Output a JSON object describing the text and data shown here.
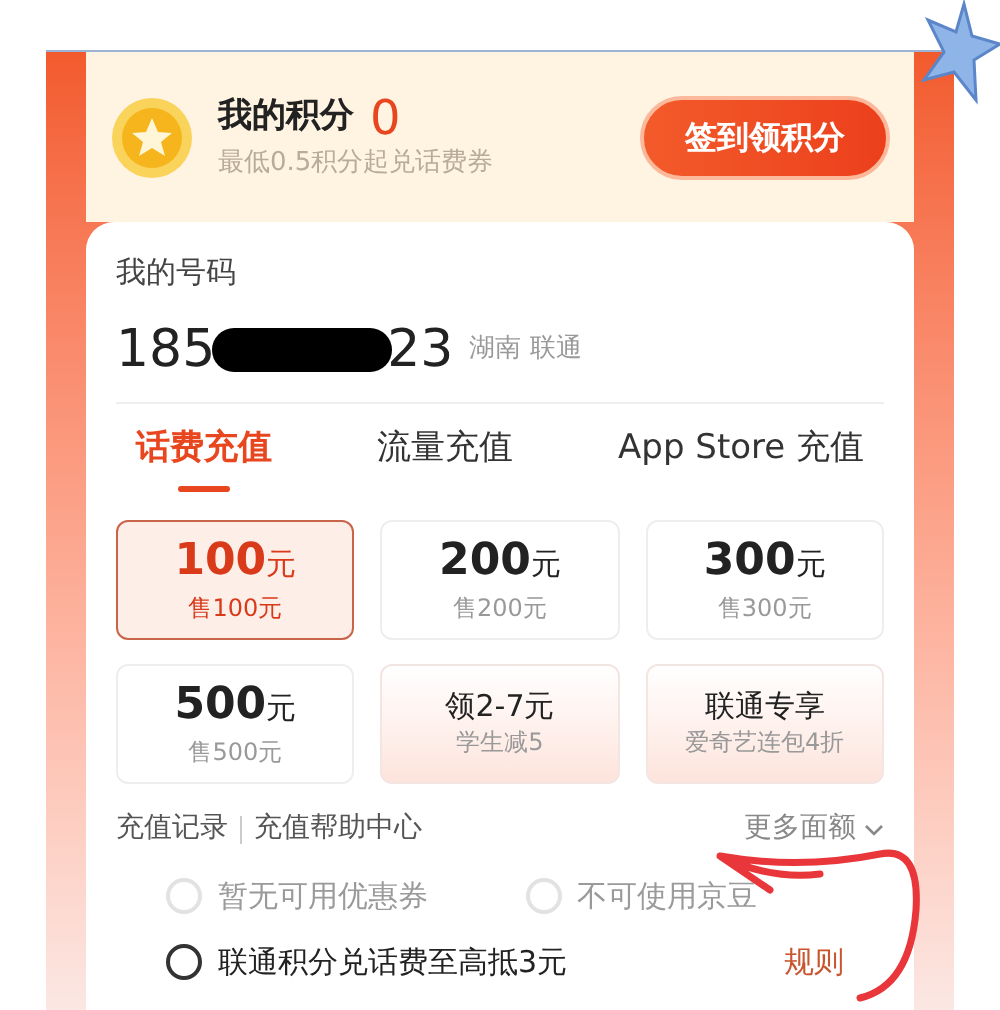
{
  "points": {
    "title": "我的积分",
    "value": "0",
    "subtitle": "最低0.5积分起兑话费券",
    "button": "签到领积分"
  },
  "number": {
    "label": "我的号码",
    "start": "185",
    "end": "23",
    "region": "湖南 联通"
  },
  "tabs": [
    {
      "label": "话费充值",
      "selected": true
    },
    {
      "label": "流量充值",
      "selected": false
    },
    {
      "label": "App Store 充值",
      "selected": false
    }
  ],
  "options": [
    {
      "kind": "amount",
      "amount": "100",
      "unit": "元",
      "sub": "售100元",
      "selected": true
    },
    {
      "kind": "amount",
      "amount": "200",
      "unit": "元",
      "sub": "售200元",
      "selected": false
    },
    {
      "kind": "amount",
      "amount": "300",
      "unit": "元",
      "sub": "售300元",
      "selected": false
    },
    {
      "kind": "amount",
      "amount": "500",
      "unit": "元",
      "sub": "售500元",
      "selected": false
    },
    {
      "kind": "promo",
      "title": "领2-7元",
      "sub": "学生减5",
      "selected": false
    },
    {
      "kind": "promo",
      "title": "联通专享",
      "sub": "爱奇艺连包4折",
      "selected": false
    }
  ],
  "links": [
    "充值记录",
    "充值帮助中心"
  ],
  "more": "更多面额",
  "discounts": [
    {
      "label": "暂无可用优惠券",
      "disabled": true,
      "checked": false
    },
    {
      "label": "不可使用京豆",
      "disabled": true,
      "checked": false
    }
  ],
  "points_offer": {
    "label": "联通积分兑话费至高抵3元",
    "checked": false,
    "rules": "规则"
  }
}
